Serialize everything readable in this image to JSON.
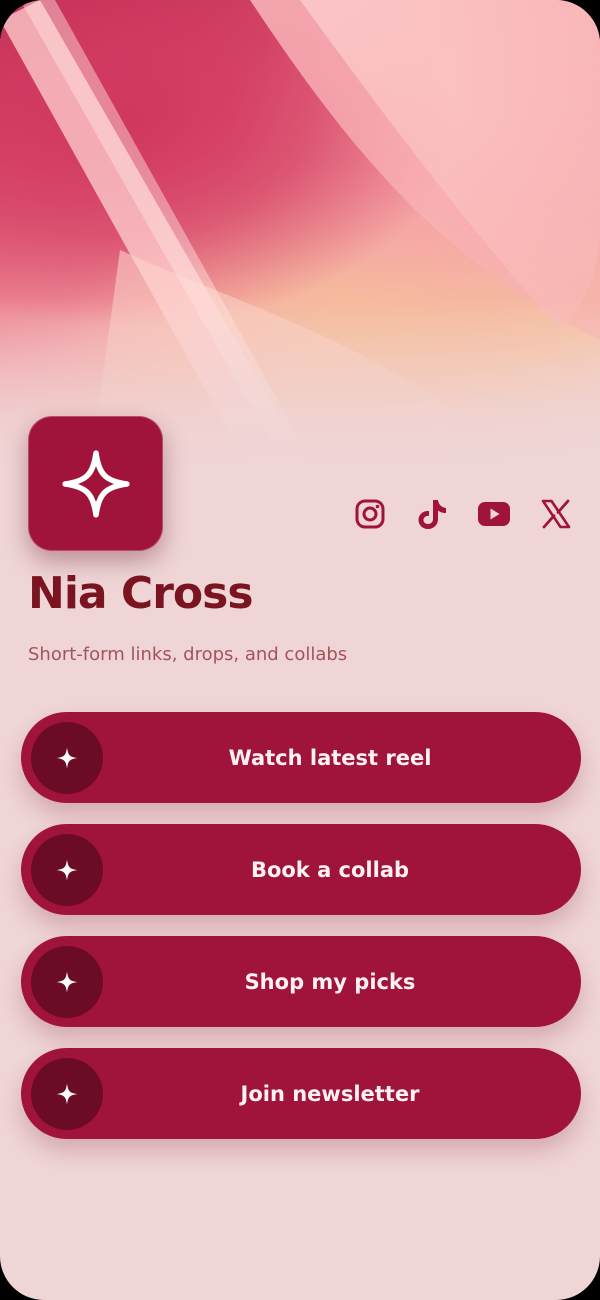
{
  "profile": {
    "name": "Nia Cross",
    "bio": "Short-form links, drops, and collabs",
    "avatar_icon": "sparkle-icon"
  },
  "socials": [
    {
      "icon": "instagram-icon"
    },
    {
      "icon": "tiktok-icon"
    },
    {
      "icon": "youtube-icon"
    },
    {
      "icon": "x-icon"
    }
  ],
  "links": [
    {
      "label": "Watch latest reel",
      "icon": "sparkle-icon"
    },
    {
      "label": "Book a collab",
      "icon": "sparkle-icon"
    },
    {
      "label": "Shop my picks",
      "icon": "sparkle-icon"
    },
    {
      "label": "Join newsletter",
      "icon": "sparkle-icon"
    }
  ],
  "colors": {
    "accent": "#a0133a",
    "accent_dark": "#6b0b26",
    "background": "#efd5d6",
    "name_text": "#7a1420",
    "bio_text": "#a3535c"
  }
}
